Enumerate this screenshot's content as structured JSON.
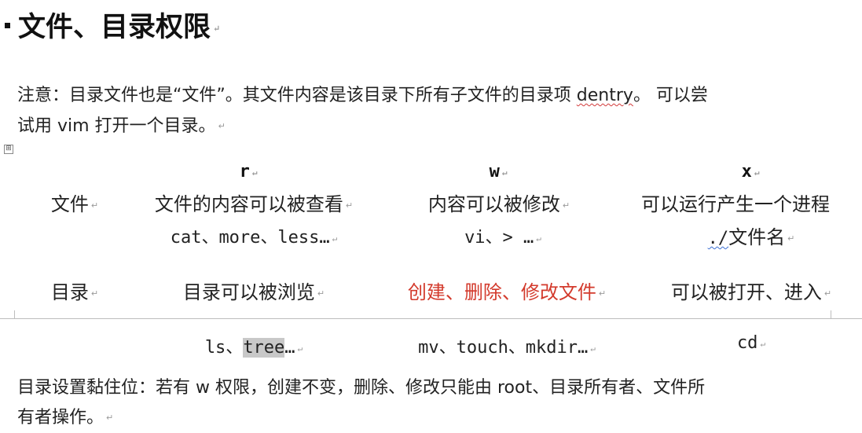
{
  "heading": "文件、目录权限",
  "note": {
    "line1_prefix": "注意：目录文件也是“文件”。其文件内容是该目录下所有子文件的目录项 ",
    "line1_term": "dentry",
    "line1_suffix": "。 可以尝",
    "line2": "试用 vim 打开一个目录。"
  },
  "table": {
    "headers": [
      "r",
      "w",
      "x"
    ],
    "rows": [
      {
        "label": "文件",
        "cells": [
          "文件的内容可以被查看",
          "内容可以被修改",
          "可以运行产生一个进程"
        ],
        "commands": [
          "cat、more、less…",
          "vi、> …",
          "./文件名"
        ]
      },
      {
        "label": "目录",
        "cells": [
          "目录可以被浏览",
          "创建、删除、修改文件",
          "可以被打开、进入"
        ],
        "commands_parts": {
          "c1_pre": "ls、",
          "c1_hl": "tree",
          "c1_post": "…",
          "c2": "mv、touch、mkdir…",
          "c3": "cd"
        }
      }
    ],
    "x_cmd_parts": {
      "dot_slash": "./",
      "rest": "文件名"
    }
  },
  "sticky": {
    "line1": "目录设置黏住位：若有 w 权限，创建不变，删除、修改只能由 root、目录所有者、文件所",
    "line2": "有者操作。"
  },
  "colors": {
    "accent_red": "#d33a2c",
    "text": "#222222",
    "highlight": "#c8c8c8"
  },
  "marks": {
    "paragraph": "↵",
    "anchor": "⊞"
  }
}
